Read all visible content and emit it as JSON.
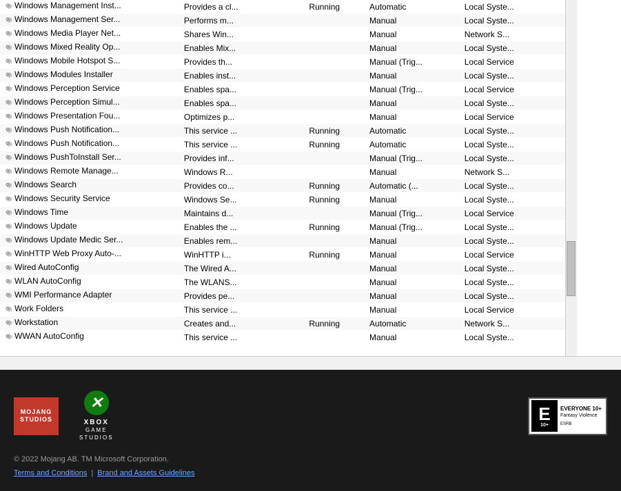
{
  "services": [
    {
      "name": "Windows Management Inst...",
      "desc": "Provides a cl...",
      "status": "Running",
      "startup": "Automatic",
      "logon": "Local Syste..."
    },
    {
      "name": "Windows Management Ser...",
      "desc": "Performs m...",
      "status": "",
      "startup": "Manual",
      "logon": "Local Syste..."
    },
    {
      "name": "Windows Media Player Net...",
      "desc": "Shares Win...",
      "status": "",
      "startup": "Manual",
      "logon": "Network S..."
    },
    {
      "name": "Windows Mixed Reality Op...",
      "desc": "Enables Mix...",
      "status": "",
      "startup": "Manual",
      "logon": "Local Syste..."
    },
    {
      "name": "Windows Mobile Hotspot S...",
      "desc": "Provides th...",
      "status": "",
      "startup": "Manual (Trig...",
      "logon": "Local Service"
    },
    {
      "name": "Windows Modules Installer",
      "desc": "Enables inst...",
      "status": "",
      "startup": "Manual",
      "logon": "Local Syste..."
    },
    {
      "name": "Windows Perception Service",
      "desc": "Enables spa...",
      "status": "",
      "startup": "Manual (Trig...",
      "logon": "Local Service"
    },
    {
      "name": "Windows Perception Simul...",
      "desc": "Enables spa...",
      "status": "",
      "startup": "Manual",
      "logon": "Local Syste..."
    },
    {
      "name": "Windows Presentation Fou...",
      "desc": "Optimizes p...",
      "status": "",
      "startup": "Manual",
      "logon": "Local Service"
    },
    {
      "name": "Windows Push Notification...",
      "desc": "This service ...",
      "status": "Running",
      "startup": "Automatic",
      "logon": "Local Syste..."
    },
    {
      "name": "Windows Push Notification...",
      "desc": "This service ...",
      "status": "Running",
      "startup": "Automatic",
      "logon": "Local Syste..."
    },
    {
      "name": "Windows PushToInstall Ser...",
      "desc": "Provides inf...",
      "status": "",
      "startup": "Manual (Trig...",
      "logon": "Local Syste..."
    },
    {
      "name": "Windows Remote Manage...",
      "desc": "Windows R...",
      "status": "",
      "startup": "Manual",
      "logon": "Network S..."
    },
    {
      "name": "Windows Search",
      "desc": "Provides co...",
      "status": "Running",
      "startup": "Automatic (...",
      "logon": "Local Syste..."
    },
    {
      "name": "Windows Security Service",
      "desc": "Windows Se...",
      "status": "Running",
      "startup": "Manual",
      "logon": "Local Syste..."
    },
    {
      "name": "Windows Time",
      "desc": "Maintains d...",
      "status": "",
      "startup": "Manual (Trig...",
      "logon": "Local Service"
    },
    {
      "name": "Windows Update",
      "desc": "Enables the ...",
      "status": "Running",
      "startup": "Manual (Trig...",
      "logon": "Local Syste..."
    },
    {
      "name": "Windows Update Medic Ser...",
      "desc": "Enables rem...",
      "status": "",
      "startup": "Manual",
      "logon": "Local Syste..."
    },
    {
      "name": "WinHTTP Web Proxy Auto-...",
      "desc": "WinHTTP i...",
      "status": "Running",
      "startup": "Manual",
      "logon": "Local Service"
    },
    {
      "name": "Wired AutoConfig",
      "desc": "The Wired A...",
      "status": "",
      "startup": "Manual",
      "logon": "Local Syste..."
    },
    {
      "name": "WLAN AutoConfig",
      "desc": "The WLANS...",
      "status": "",
      "startup": "Manual",
      "logon": "Local Syste..."
    },
    {
      "name": "WMI Performance Adapter",
      "desc": "Provides pe...",
      "status": "",
      "startup": "Manual",
      "logon": "Local Syste..."
    },
    {
      "name": "Work Folders",
      "desc": "This service ...",
      "status": "",
      "startup": "Manual",
      "logon": "Local Service"
    },
    {
      "name": "Workstation",
      "desc": "Creates and...",
      "status": "Running",
      "startup": "Automatic",
      "logon": "Network S..."
    },
    {
      "name": "WWAN AutoConfig",
      "desc": "This service ...",
      "status": "",
      "startup": "Manual",
      "logon": "Local Syste..."
    }
  ],
  "footer": {
    "copyright": "© 2022 Mojang AB. TM Microsoft Corporation.",
    "terms_label": "Terms and Conditions",
    "brand_label": "Brand and Assets Guidelines",
    "esrb_everyone": "EVERYONE 10+",
    "esrb_descriptor": "Fantasy Violence",
    "esrb_label": "ESRB",
    "mojang_line1": "MOJANG",
    "mojang_line2": "STUDIOS",
    "xbox_line1": "GAME",
    "xbox_line2": "STUDIOS"
  }
}
